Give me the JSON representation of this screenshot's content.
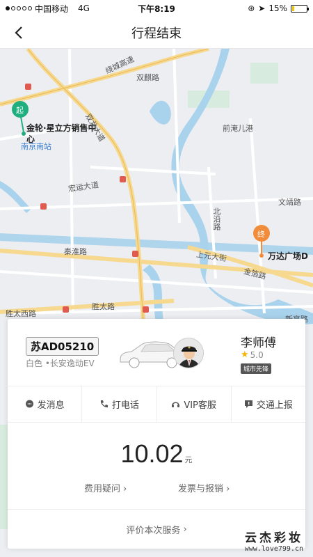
{
  "status_bar": {
    "carrier": "中国移动",
    "network": "4G",
    "time": "下午8:19",
    "battery": "15%"
  },
  "nav": {
    "title": "行程结束"
  },
  "map": {
    "start_marker": "起",
    "end_marker": "终",
    "start_place": "金轮·星立方销售中心",
    "end_place": "万达广场D",
    "labels": {
      "shuanglin": "双麒路",
      "ring_road": "绕城高速",
      "shuanglong": "双龙大道",
      "nanjing_south": "南京南站",
      "hongyun": "宏运大道",
      "qianyuan": "前淹儿港",
      "beiyan": "北沿路",
      "wenjing": "文靖路",
      "qinhuai": "秦淮路",
      "shangyuan": "上元大街",
      "jinxiao": "金箔路",
      "shengtai_west": "胜太西路",
      "shengtai": "胜太路",
      "xinting": "新亭路"
    }
  },
  "driver": {
    "plate": "苏AD05210",
    "car_desc": "白色 •长安逸动EV",
    "name": "李师傅",
    "rating": "5.0",
    "tag": "城市先锋"
  },
  "actions": [
    {
      "label": "发消息",
      "icon": "message-icon"
    },
    {
      "label": "打电话",
      "icon": "phone-icon"
    },
    {
      "label": "VIP客服",
      "icon": "headset-icon"
    },
    {
      "label": "交通上报",
      "icon": "report-icon"
    }
  ],
  "fare": {
    "amount": "10.02",
    "unit": "元",
    "question": "费用疑问",
    "invoice": "发票与报销"
  },
  "review": {
    "label": "评价本次服务"
  },
  "watermark": {
    "text": "云杰彩妆",
    "url": "www.love799.cn"
  },
  "colors": {
    "start": "#1fae7e",
    "end": "#f08c3a",
    "road_major": "#f6d98e",
    "water": "#a9d2ec"
  }
}
